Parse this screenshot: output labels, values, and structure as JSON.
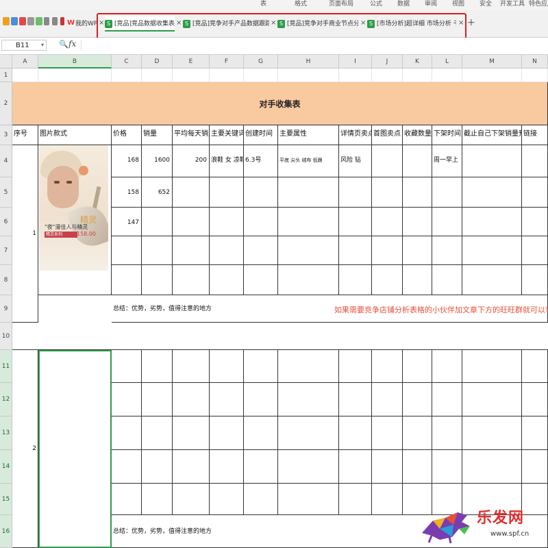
{
  "ribbon": {
    "partial_labels": [
      "表",
      "格式",
      "页面布局",
      "公式",
      "数据",
      "审阅",
      "视图",
      "安全",
      "开发工具",
      "特色应用"
    ]
  },
  "tabs": [
    {
      "label": "我的WPS",
      "icon": "wps-logo"
    },
    {
      "label": "[竞品]竞品数据收集表.xlsx",
      "active": true
    },
    {
      "label": "[竞品]竞争对手产品数据跟踪表.xlsx"
    },
    {
      "label": "[竞品]竞争对手商业节点分析.xlsx"
    },
    {
      "label": "[市场分析]超详细 市场分析 干货.xlsm"
    }
  ],
  "formula_bar": {
    "cell_ref": "B11",
    "fx_label": "fx",
    "value": ""
  },
  "columns": [
    "A",
    "B",
    "C",
    "D",
    "E",
    "F",
    "G",
    "H",
    "I",
    "J",
    "K",
    "L",
    "M",
    "N"
  ],
  "rows": [
    "1",
    "2",
    "3",
    "4",
    "5",
    "6",
    "7",
    "8",
    "9",
    "10",
    "11",
    "12",
    "13",
    "14",
    "15",
    "16"
  ],
  "sheet": {
    "title": "对手收集表",
    "headers": [
      "序号",
      "图片款式",
      "价格",
      "销量",
      "平均每天销量",
      "主要关键词",
      "创建时间",
      "主要属性",
      "详情页卖点",
      "首图卖点",
      "收藏数量",
      "下架时间",
      "截止自己下架销量预计",
      "链接"
    ],
    "record1": {
      "index": "1",
      "rows": [
        {
          "price": "168",
          "sales": "1600",
          "daily": "200",
          "keywords": "浪鞋 女 凉鞋",
          "created": "6.3号",
          "attributes": "平底 尖头 绒布 低跟",
          "detail_point": "风险 钻",
          "unshelf": "周一早上"
        },
        {
          "price": "158",
          "sales": "652"
        },
        {
          "price": "147"
        }
      ],
      "summary": "总结：优势，劣势，值得注意的地方",
      "promo": "如果需要竞争店铺分析表格的小伙伴加文章下方的旺旺群就可以领取了哈",
      "image": {
        "slogan": "\"夜\"漫佳人与精灵",
        "banner": "精灵系列",
        "price": "158.00",
        "headline": "精灵"
      }
    },
    "record2": {
      "index": "2",
      "summary": "总结：优势，劣势，值得注意的地方"
    }
  },
  "watermark": {
    "brand": "乐发网",
    "site": "www.spf.cn"
  },
  "colors": {
    "title_band": "#f9c9a0",
    "promo_text": "#e8503a",
    "selection": "#2e9c47",
    "highlight": "#d61f1f"
  }
}
